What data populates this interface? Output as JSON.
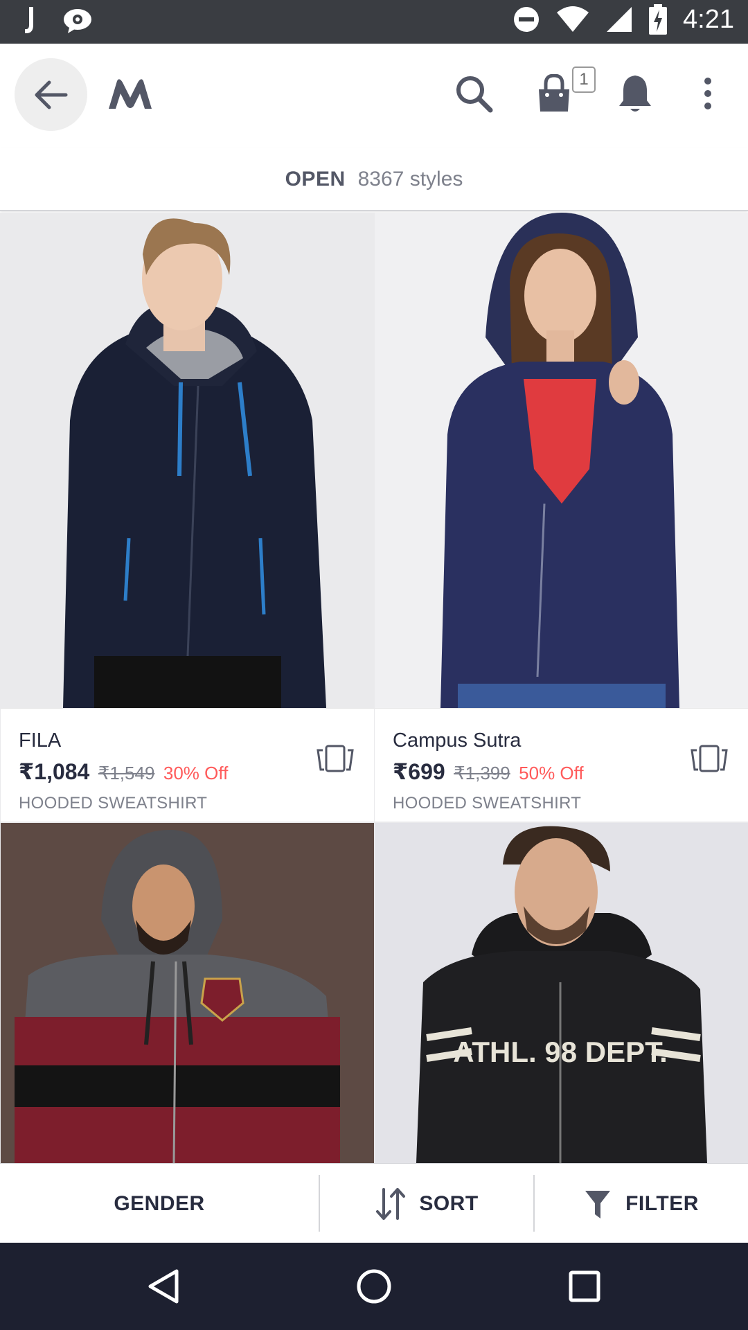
{
  "status_bar": {
    "time": "4:21",
    "left_icons": [
      "j-app-icon",
      "messenger-icon"
    ],
    "right_icons": [
      "do-not-disturb-icon",
      "wifi-icon",
      "signal-icon",
      "battery-charging-icon"
    ]
  },
  "app_bar": {
    "back_icon": "arrow-left-icon",
    "logo_icon": "myntra-logo",
    "actions": [
      "search-icon",
      "bag-icon",
      "bell-icon",
      "more-vert-icon"
    ],
    "bag_count": "1"
  },
  "listing": {
    "title": "OPEN",
    "count": "8367 styles"
  },
  "products": [
    {
      "brand": "FILA",
      "price": "₹1,084",
      "mrp": "₹1,549",
      "discount": "30% Off",
      "category": "HOODED SWEATSHIRT"
    },
    {
      "brand": "Campus Sutra",
      "price": "₹699",
      "mrp": "₹1,399",
      "discount": "50% Off",
      "category": "HOODED SWEATSHIRT"
    },
    {
      "print": ""
    },
    {
      "print": "ATHL. 98 DEPT."
    }
  ],
  "action_bar": {
    "gender": "GENDER",
    "sort": "SORT",
    "filter": "FILTER"
  },
  "colors": {
    "primary_text": "#282c3f",
    "secondary_text": "#7e818c",
    "discount": "#ff5a5a",
    "status_bar": "#3a3d42",
    "nav_bar": "#1d2030"
  },
  "nav_bar": {
    "icons": [
      "back-triangle-icon",
      "home-circle-icon",
      "recents-square-icon"
    ]
  }
}
